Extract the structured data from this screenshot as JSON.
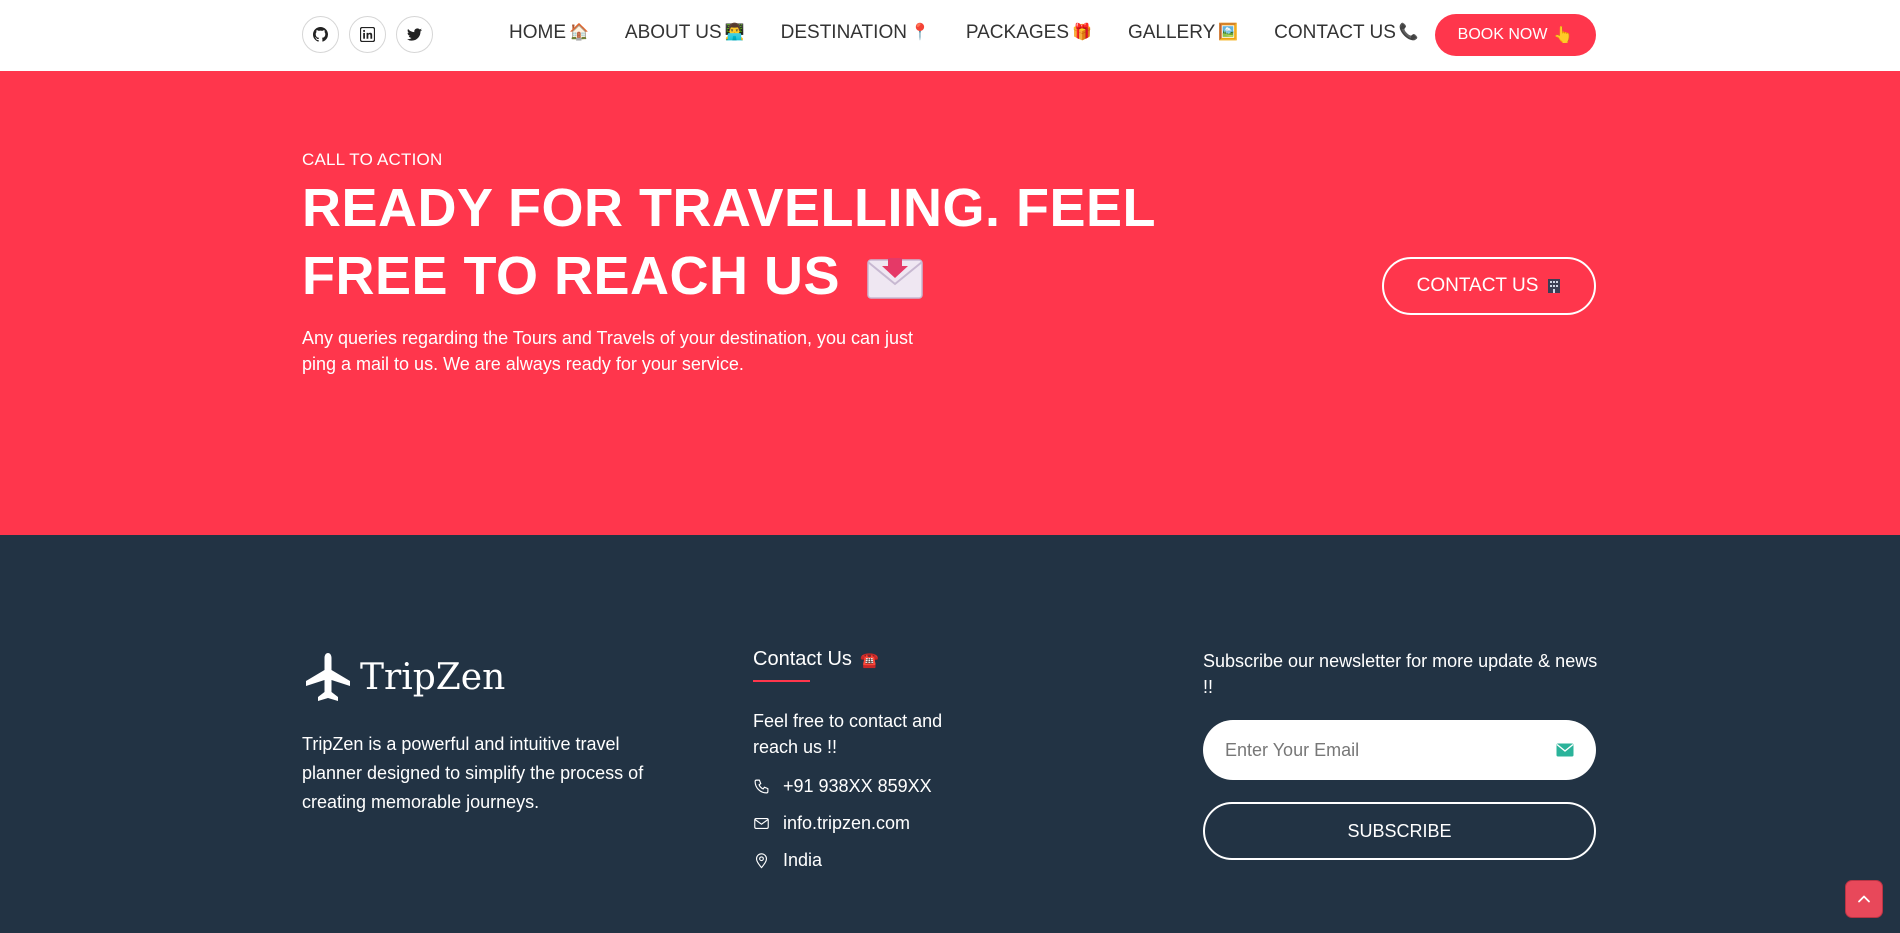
{
  "header": {
    "social": [
      {
        "icon": "github-icon"
      },
      {
        "icon": "linkedin-icon"
      },
      {
        "icon": "twitter-icon"
      }
    ],
    "nav": [
      {
        "label": "HOME",
        "emoji": "🏠"
      },
      {
        "label": "ABOUT US",
        "emoji": "👨‍💻"
      },
      {
        "label": "DESTINATION",
        "emoji": "📍"
      },
      {
        "label": "PACKAGES",
        "emoji": "🎁"
      },
      {
        "label": "GALLERY",
        "emoji": "🖼️"
      },
      {
        "label": "CONTACT US",
        "emoji": "📞"
      }
    ],
    "book_now": {
      "label": "BOOK NOW",
      "emoji": "👆"
    }
  },
  "cta": {
    "kicker": "CALL TO ACTION",
    "title": "READY FOR TRAVELLING. FEEL FREE TO REACH US",
    "title_icon": "envelope-icon",
    "description": "Any queries regarding the Tours and Travels of your destination, you can just ping a mail to us. We are always ready for your service.",
    "contact_button": "CONTACT US",
    "contact_button_icon": "building-icon"
  },
  "footer": {
    "logo_text": "TripZen",
    "about": "TripZen is a powerful and intuitive travel planner designed to simplify the process of creating memorable journeys.",
    "contact": {
      "heading": "Contact Us",
      "heading_emoji": "☎️",
      "description": "Feel free to contact and reach us !!",
      "phone": "+91 938XX 859XX",
      "email": "info.tripzen.com",
      "location": "India"
    },
    "newsletter": {
      "text": "Subscribe our newsletter for more update & news !!",
      "email_placeholder": "Enter Your Email",
      "subscribe_label": "SUBSCRIBE"
    }
  },
  "colors": {
    "accent": "#ff364c",
    "footer_bg": "#223344",
    "scroll_top_bg": "#e8485a"
  }
}
